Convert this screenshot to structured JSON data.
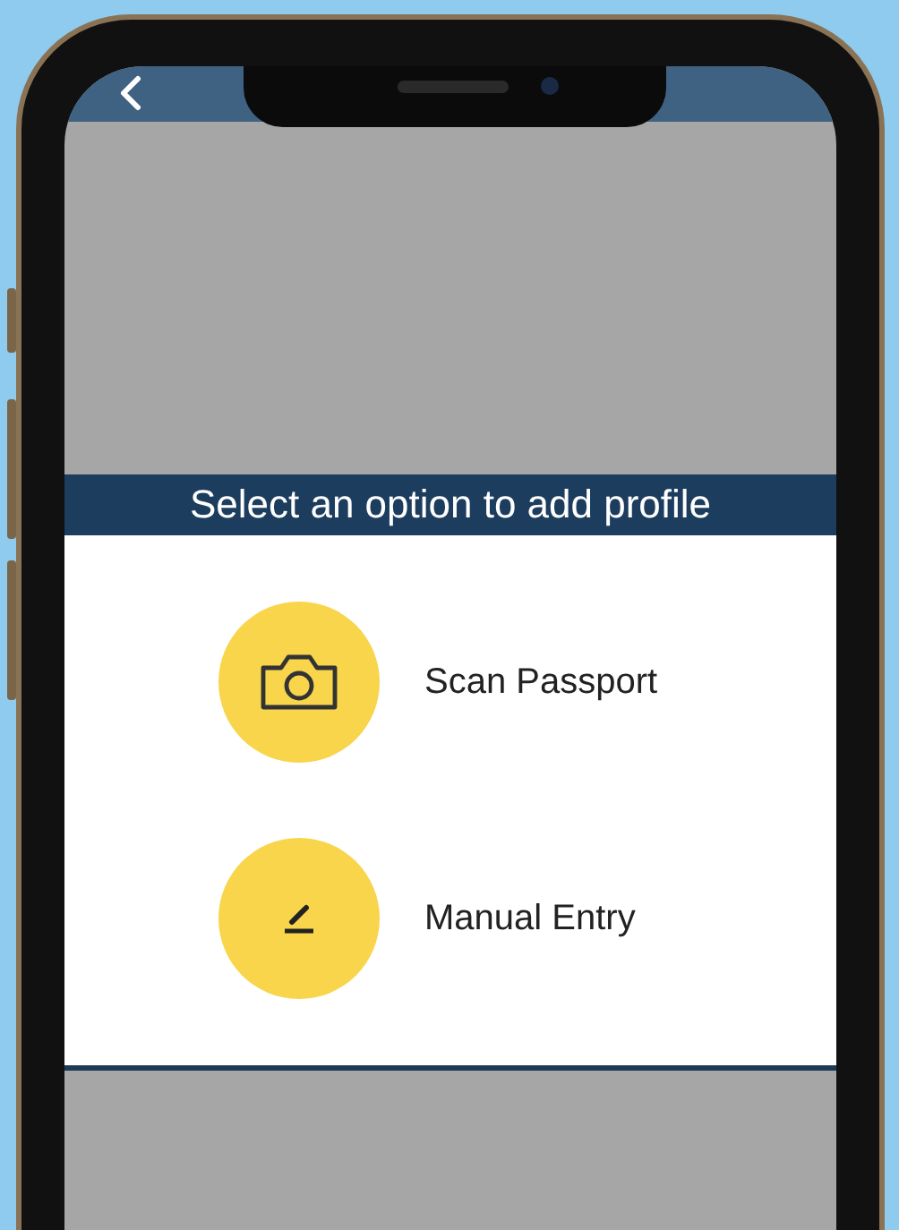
{
  "header": {
    "title": "Select an option to add profile"
  },
  "options": [
    {
      "label": "Scan Passport",
      "kind": "camera"
    },
    {
      "label": "Manual Entry",
      "kind": "pencil"
    }
  ]
}
